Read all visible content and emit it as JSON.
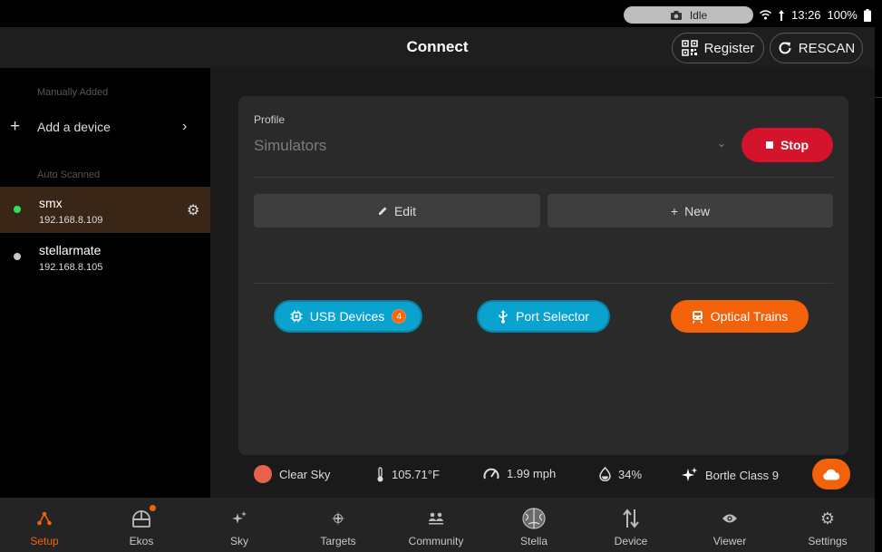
{
  "status_bar": {
    "pill_text": "Idle",
    "time": "13:26",
    "battery": "100%"
  },
  "app_bar": {
    "title": "Connect",
    "register_label": "Register",
    "rescan_label": "RESCAN"
  },
  "sidebar": {
    "manual_section": "Manually Added",
    "add_device_label": "Add a device",
    "auto_section": "Auto Scanned",
    "devices": [
      {
        "name": "smx",
        "ip": "192.168.8.109",
        "status_color": "#2ee05a"
      },
      {
        "name": "stellarmate",
        "ip": "192.168.8.105",
        "status_color": "#c8c8c8"
      }
    ]
  },
  "profile": {
    "label": "Profile",
    "value": "Simulators",
    "stop_label": "Stop",
    "edit_label": "Edit",
    "new_label": "New"
  },
  "actions": {
    "usb_label": "USB Devices",
    "usb_count": "4",
    "port_label": "Port Selector",
    "optical_label": "Optical Trains"
  },
  "weather": {
    "sky": "Clear Sky",
    "temperature": "105.71°F",
    "wind": "1.99 mph",
    "humidity": "34%",
    "bortle": "Bortle Class 9"
  },
  "nav": {
    "items": [
      {
        "label": "Setup"
      },
      {
        "label": "Ekos"
      },
      {
        "label": "Sky"
      },
      {
        "label": "Targets"
      },
      {
        "label": "Community"
      },
      {
        "label": "Stella"
      },
      {
        "label": "Device"
      },
      {
        "label": "Viewer"
      },
      {
        "label": "Settings"
      }
    ]
  },
  "colors": {
    "accent": "#f2620a",
    "stop": "#d4142a",
    "cyan": "#0aa2cf",
    "active_row": "#3a2616",
    "sky_dot": "#e8614a"
  }
}
